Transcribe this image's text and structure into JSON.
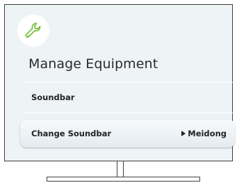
{
  "screen": {
    "icon": "wrench-icon",
    "accent_color": "#7ac143",
    "title": "Manage Equipment",
    "section_label": "Soundbar",
    "menu_item": {
      "label": "Change Soundbar",
      "value": "Meidong"
    }
  }
}
